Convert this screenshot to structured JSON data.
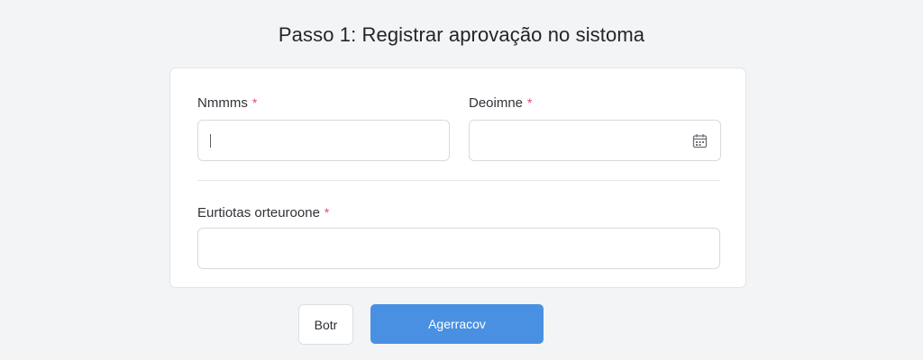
{
  "page": {
    "title": "Passo 1: Registrar aprovação no sistoma"
  },
  "form": {
    "name_field": {
      "label": "Nmmms",
      "required_mark": "*",
      "value": ""
    },
    "date_field": {
      "label": "Deoimne",
      "required_mark": "*",
      "value": "",
      "icon": "calendar-icon"
    },
    "approval_field": {
      "label": "Eurtiotas orteuroone",
      "required_mark": "*",
      "value": ""
    }
  },
  "actions": {
    "back_label": "Botr",
    "submit_label": "Agerracov"
  },
  "colors": {
    "primary": "#4a90e2",
    "required": "#e2477a",
    "background": "#f3f4f5"
  }
}
